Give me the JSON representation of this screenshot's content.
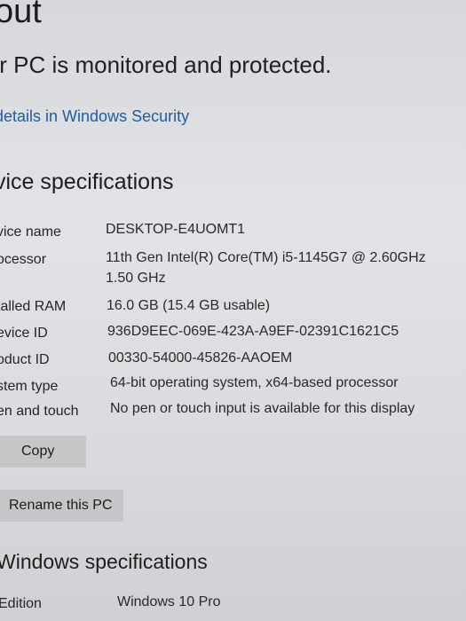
{
  "header": {
    "title": "out",
    "status": "ır PC is monitored and protected.",
    "security_link": "details in Windows Security"
  },
  "device_specs": {
    "section_title": "vice specifications",
    "rows": [
      {
        "label": "vice name",
        "value": "DESKTOP-E4UOMT1"
      },
      {
        "label": "ocessor",
        "value": "11th Gen Intel(R) Core(TM) i5-1145G7 @ 2.60GHz",
        "value2": "1.50 GHz"
      },
      {
        "label": "talled RAM",
        "value": "16.0 GB (15.4 GB usable)"
      },
      {
        "label": "evice ID",
        "value": "936D9EEC-069E-423A-A9EF-02391C1621C5"
      },
      {
        "label": "oduct ID",
        "value": "00330-54000-45826-AAOEM"
      },
      {
        "label": "stem type",
        "value": "64-bit operating system, x64-based processor"
      },
      {
        "label": "en and touch",
        "value": "No pen or touch input is available for this display"
      }
    ],
    "copy_label": "Copy",
    "rename_label": "Rename this PC"
  },
  "windows_specs": {
    "section_title": "Windows specifications",
    "rows": [
      {
        "label": "Edition",
        "value": "Windows 10 Pro"
      }
    ]
  }
}
